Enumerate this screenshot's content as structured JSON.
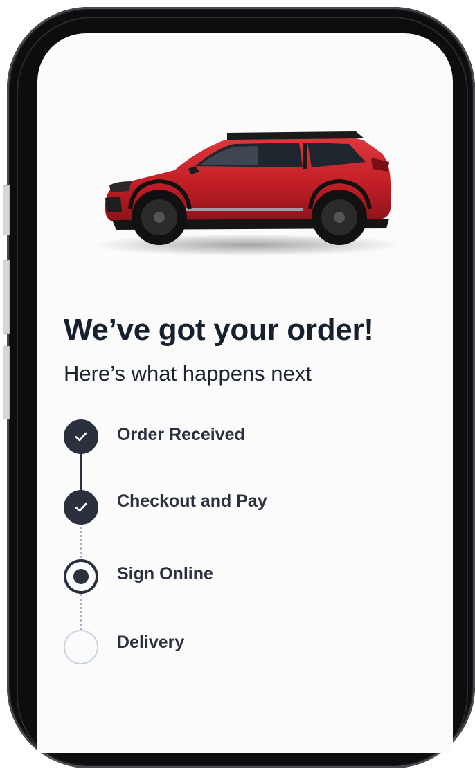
{
  "heading": {
    "title": "We’ve got your order!",
    "subtitle": "Here’s what happens next"
  },
  "hero": {
    "image_icon": "red-suv-car",
    "car_color": "#c8232c"
  },
  "steps": [
    {
      "label": "Order Received",
      "status": "completed",
      "icon": "check-icon"
    },
    {
      "label": "Checkout and Pay",
      "status": "completed",
      "icon": "check-icon"
    },
    {
      "label": "Sign Online",
      "status": "current",
      "icon": "radio-dot-icon"
    },
    {
      "label": "Delivery",
      "status": "pending",
      "icon": "empty-circle-icon"
    }
  ],
  "colors": {
    "text_dark": "#17212d",
    "step_dark": "#2a313d",
    "dotted_line": "#a7b5c8",
    "pending_ring": "#c9d3df"
  }
}
